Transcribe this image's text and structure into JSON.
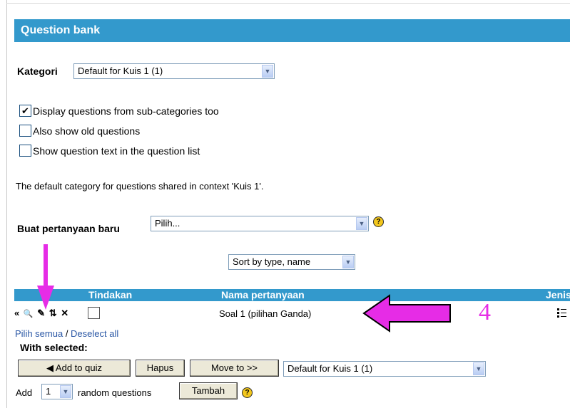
{
  "title": "Question bank",
  "category": {
    "label": "Kategori",
    "value": "Default for Kuis 1 (1)"
  },
  "options": [
    {
      "label": "Display questions from sub-categories too",
      "checked": true
    },
    {
      "label": "Also show old questions",
      "checked": false
    },
    {
      "label": "Show question text in the question list",
      "checked": false
    }
  ],
  "default_info": "The default category for questions shared in context 'Kuis 1'.",
  "new_question": {
    "label": "Buat pertanyaan baru",
    "value": "Pilih...",
    "help": "?"
  },
  "sort": {
    "value": "Sort by type, name"
  },
  "table": {
    "headers": {
      "actions": "Tindakan",
      "name": "Nama pertanyaan",
      "type": "Jenis"
    },
    "rows": [
      {
        "icons": [
          "«",
          "🔍",
          "✎",
          "⇅",
          "✕"
        ],
        "name": "Soal 1 (pilihan Ganda)",
        "type_icon": "multichoice-icon"
      }
    ]
  },
  "select_links": {
    "all": "Pilih semua",
    "sep": " / ",
    "none": "Deselect all"
  },
  "with_selected": {
    "label": "With selected:",
    "add_to_quiz": "◀ Add to quiz",
    "delete": "Hapus",
    "move_to": "Move to >>",
    "target_category": "Default for Kuis 1 (1)"
  },
  "random": {
    "prefix": "Add",
    "count": "1",
    "suffix": "random questions",
    "button": "Tambah",
    "help": "?"
  },
  "annotation_number": "4",
  "colors": {
    "header": "#3399cc",
    "annotation": "#e62ce6",
    "help": "#f3c71c"
  }
}
